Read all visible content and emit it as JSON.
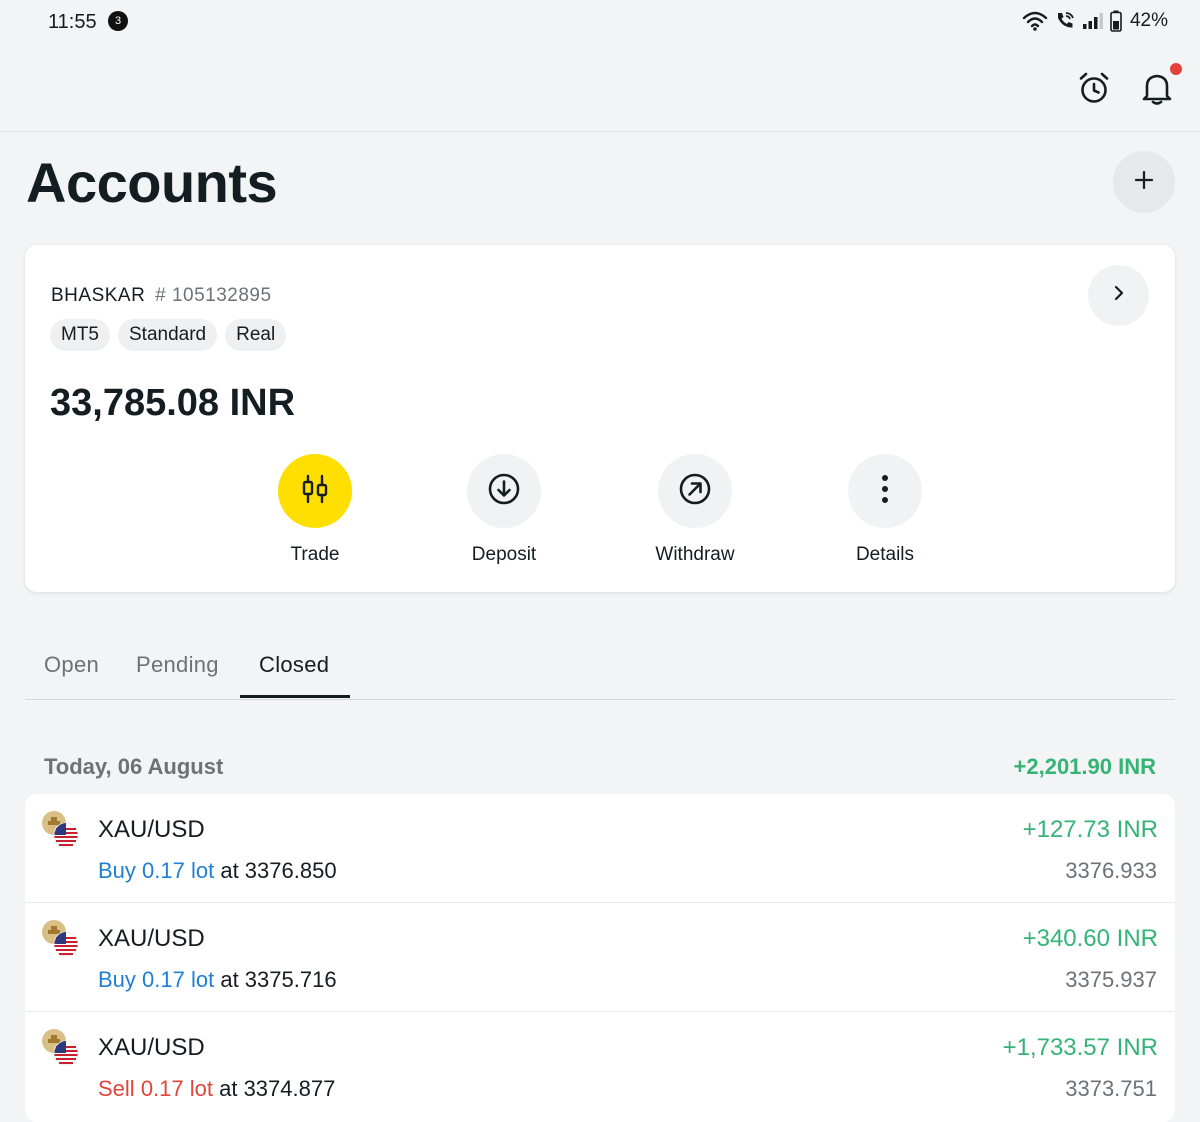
{
  "status_bar": {
    "time": "11:55",
    "notification_count": "3",
    "battery": "42%",
    "icons": [
      "wifi-icon",
      "wifi-calling-icon",
      "signal-icon",
      "battery-icon"
    ]
  },
  "top_bar": {
    "icons": [
      "alarm-icon",
      "bell-icon"
    ],
    "has_unread_notifications": true
  },
  "page_title": "Accounts",
  "account": {
    "name": "BHASKAR",
    "number": "# 105132895",
    "tags": [
      "MT5",
      "Standard",
      "Real"
    ],
    "balance": "33,785.08 INR",
    "actions": [
      {
        "label": "Trade",
        "icon": "candlestick-icon",
        "primary": true
      },
      {
        "label": "Deposit",
        "icon": "download-circle-icon",
        "primary": false
      },
      {
        "label": "Withdraw",
        "icon": "upload-circle-icon",
        "primary": false
      },
      {
        "label": "Details",
        "icon": "more-vertical-icon",
        "primary": false
      }
    ]
  },
  "tabs": [
    {
      "label": "Open",
      "active": false
    },
    {
      "label": "Pending",
      "active": false
    },
    {
      "label": "Closed",
      "active": true
    }
  ],
  "group": {
    "date": "Today, 06 August",
    "total": "+2,201.90 INR"
  },
  "trades": [
    {
      "symbol": "XAU/USD",
      "side": "Buy",
      "lot": "0.17 lot",
      "at": "at 3376.850",
      "profit": "+127.73 INR",
      "close_price": "3376.933"
    },
    {
      "symbol": "XAU/USD",
      "side": "Buy",
      "lot": "0.17 lot",
      "at": "at 3375.716",
      "profit": "+340.60 INR",
      "close_price": "3375.937"
    },
    {
      "symbol": "XAU/USD",
      "side": "Sell",
      "lot": "0.17 lot",
      "at": "at 3374.877",
      "profit": "+1,733.57 INR",
      "close_price": "3373.751"
    }
  ],
  "colors": {
    "accent_yellow": "#ffde02",
    "profit_green": "#36b375",
    "buy_blue": "#1f7fd4",
    "sell_red": "#e0453b",
    "notification_red": "#e5413b"
  }
}
